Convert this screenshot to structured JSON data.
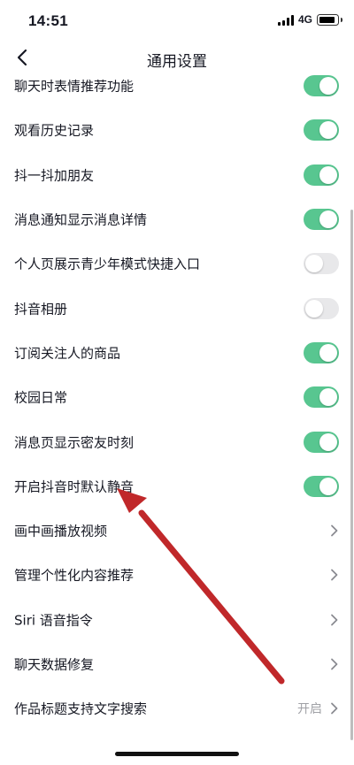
{
  "status_bar": {
    "time": "14:51",
    "network": "4G"
  },
  "nav": {
    "title": "通用设置"
  },
  "settings": [
    {
      "label": "聊天时表情推荐功能",
      "control": "toggle",
      "on": true
    },
    {
      "label": "观看历史记录",
      "control": "toggle",
      "on": true
    },
    {
      "label": "抖一抖加朋友",
      "control": "toggle",
      "on": true
    },
    {
      "label": "消息通知显示消息详情",
      "control": "toggle",
      "on": true
    },
    {
      "label": "个人页展示青少年模式快捷入口",
      "control": "toggle",
      "on": false
    },
    {
      "label": "抖音相册",
      "control": "toggle",
      "on": false
    },
    {
      "label": "订阅关注人的商品",
      "control": "toggle",
      "on": true
    },
    {
      "label": "校园日常",
      "control": "toggle",
      "on": true
    },
    {
      "label": "消息页显示密友时刻",
      "control": "toggle",
      "on": true
    },
    {
      "label": "开启抖音时默认静音",
      "control": "toggle",
      "on": true
    },
    {
      "label": "画中画播放视频",
      "control": "chevron"
    },
    {
      "label": "管理个性化内容推荐",
      "control": "chevron"
    },
    {
      "label": "Siri 语音指令",
      "control": "chevron"
    },
    {
      "label": "聊天数据修复",
      "control": "chevron"
    },
    {
      "label": "作品标题支持文字搜索",
      "control": "chevron",
      "value": "开启"
    }
  ],
  "colors": {
    "toggle_on": "#58c690",
    "toggle_off": "#e8e8ea",
    "annotation_arrow": "#c0282a"
  },
  "icons": {
    "back": "chevron-left-icon",
    "row_arrow": "chevron-right-icon"
  }
}
